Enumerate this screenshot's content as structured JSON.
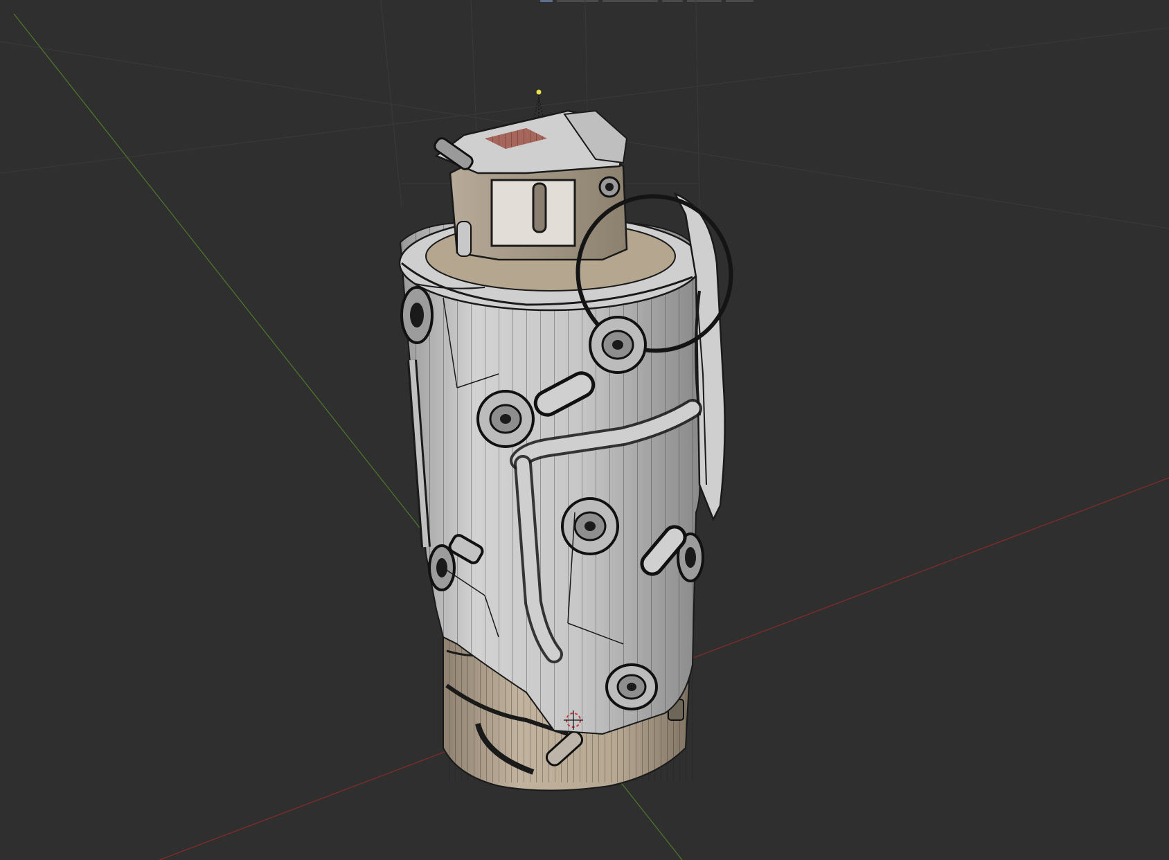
{
  "viewport": {
    "mode": "3d-viewport-wireframe-overlay",
    "background_color": "#2f2f2f",
    "grid_color": "#3a3a3a",
    "x_axis_color": "#8a2a2a",
    "y_axis_color": "#4f7a2a"
  },
  "model": {
    "body_color": "#c8c8c8",
    "base_color": "#b8a894",
    "wire_color": "#1a1a1a",
    "ring_color": "#141414",
    "cap_color": "#d6d1c9",
    "icons": [
      "light-lamp-icon",
      "3d-cursor-icon"
    ]
  }
}
